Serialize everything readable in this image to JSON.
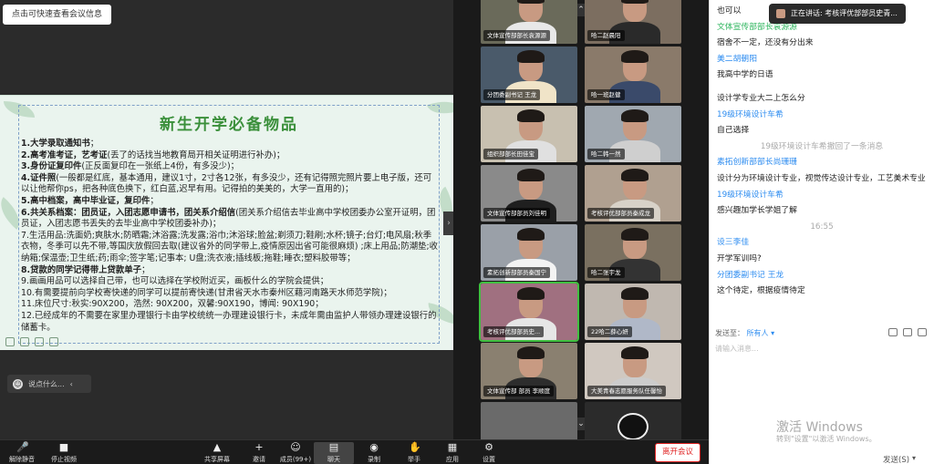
{
  "tip": "点击可快速查看会议信息",
  "slide": {
    "title": "新生开学必备物品",
    "items": [
      {
        "bold": "1.大学录取通知书",
        "rest": "；"
      },
      {
        "bold": "2.高考准考证，艺考证",
        "rest": "(丢了的话找当地教育局开相关证明进行补办)；"
      },
      {
        "bold": "3.身份证复印件",
        "rest": "(正反面复印在一张纸上4份，有多没少)；"
      },
      {
        "bold": "4.证件照",
        "rest": "(一般都是红底，基本通用，建议1寸，2寸各12张，有多没少，还有记得照完照片要上电子版，还可以让他帮你ps，把各种底色换下，红白蓝,迟早有用。记得拍的美美的，大学一直用的)；"
      },
      {
        "bold": "5.高中档案，高中毕业证，复印件",
        "rest": "；"
      },
      {
        "bold": "6.共关系档案：团员证，入团志愿申请书，团关系介绍信",
        "rest": "(团关系介绍信去毕业高中学校团委办公室开证明，团员证，入团志愿书丢失的去毕业高中学校团委补办)；"
      },
      {
        "bold": "",
        "rest": "7.生活用品:洗面奶;爽肤水;防晒霜;沐浴露;洗发露;浴巾;沐浴球;脸盆;剃须刀;鞋刷;水杯;镜子;台灯;电风扇;秋季衣物，冬季可以先不带,等国庆放假回去取(建议省外的同学带上,疫情原因出省可能很麻烦) ;床上用品;防潮垫;收纳箱;保温壶;卫生纸;药;雨伞;签字笔;记事本; U盘;洗衣液;插线板;拖鞋;睡衣;塑料胶带等；"
      },
      {
        "bold": "8.贷款的同学记得带上贷款单子",
        "rest": "；"
      },
      {
        "bold": "",
        "rest": "9.画画用品可以选择自己带，也可以选择在学校附近买，画板什么的学院会提供；"
      },
      {
        "bold": "",
        "rest": "10.有需要提前向学校寄快递的同学可以提前寄快递(甘肃省天水市秦州区藉河南路天水师范学院)；"
      },
      {
        "bold": "",
        "rest": "11.床位尺寸:秋实:90X200，浩然: 90X200，双馨:90X190，博闻: 90X190；"
      },
      {
        "bold": "",
        "rest": "12.已经成年的不需要在家里办理银行卡由学校统统一办理建设银行卡，未成年需由监护人带领办理建设银行的储蓄卡。"
      }
    ]
  },
  "chatbar": {
    "placeholder": "说点什么..."
  },
  "gallery": {
    "tiles": [
      "文体宣传部部长袁源源",
      "哈二赵晨阳",
      "分团委副书记 王龙",
      "哈一班赵健",
      "组织部部长田佳宝",
      "哈二韩一然",
      "文体宣传部部员刘佳明",
      "考核评优部部员秦成龙",
      "素拓创新部部员秦国宁",
      "哈二张宇龙",
      "考核评优部部员史...",
      "22哈二薛心妍",
      "文体宣传部 部员 李顺度",
      "大美青春志愿服务队任馨怡",
      "",
      ""
    ]
  },
  "speaking": "正在讲话: 考核评优部部员史青...",
  "chat": {
    "messages": [
      {
        "type": "msg",
        "text": "也可以"
      },
      {
        "type": "sender",
        "text": "文体宣传部部长袁源源",
        "color": "#2db55d"
      },
      {
        "type": "msg",
        "text": "宿舍不一定，还没有分出来"
      },
      {
        "type": "sender",
        "text": "美二胡朝阳"
      },
      {
        "type": "msg",
        "text": "我高中学的日语"
      },
      {
        "type": "msg",
        "text": ""
      },
      {
        "type": "msg",
        "text": "设计学专业大二上怎么分"
      },
      {
        "type": "sender",
        "text": "19级环境设计车希"
      },
      {
        "type": "msg",
        "text": "自己选择"
      },
      {
        "type": "sys",
        "text": "19级环境设计车希撤回了一条消息"
      },
      {
        "type": "sender",
        "text": "素拓创新部部长尚珊珊"
      },
      {
        "type": "msg",
        "text": "设计分为环境设计专业，视觉传达设计专业，工艺美术专业"
      },
      {
        "type": "sender",
        "text": "19级环境设计车希"
      },
      {
        "type": "msg",
        "text": "感兴趣加学长学姐了解"
      },
      {
        "type": "sys",
        "text": "16:55"
      },
      {
        "type": "sender",
        "text": "设三李佳"
      },
      {
        "type": "msg",
        "text": "开学军训吗?"
      },
      {
        "type": "sender",
        "text": "分团委副书记 王龙"
      },
      {
        "type": "msg",
        "text": "这个待定，根据疫情待定"
      }
    ],
    "send_to_label": "发送至：",
    "send_to_value": "所有人",
    "input_placeholder": "请输入消息...",
    "send_label": "发送(S)",
    "watermark_1": "激活 Windows",
    "watermark_2": "转到\"设置\"以激活 Windows。"
  },
  "toolbar": {
    "items": [
      {
        "label": "解除静音",
        "icon": "🎤"
      },
      {
        "label": "停止视频",
        "icon": "■"
      },
      {
        "label": "共享屏幕",
        "icon": "▲"
      },
      {
        "label": "邀请",
        "icon": "+"
      },
      {
        "label": "成员(99+)",
        "icon": "☺"
      },
      {
        "label": "聊天",
        "icon": "▤"
      },
      {
        "label": "录制",
        "icon": "◉"
      },
      {
        "label": "举手",
        "icon": "✋"
      },
      {
        "label": "应用",
        "icon": "▦"
      },
      {
        "label": "设置",
        "icon": "⚙"
      }
    ],
    "leave_label": "离开会议"
  },
  "colors": {
    "accent": "#2d8cf0",
    "leave": "#e02424",
    "slide_title": "#3a8f3a",
    "active_speaker": "#40c040"
  }
}
